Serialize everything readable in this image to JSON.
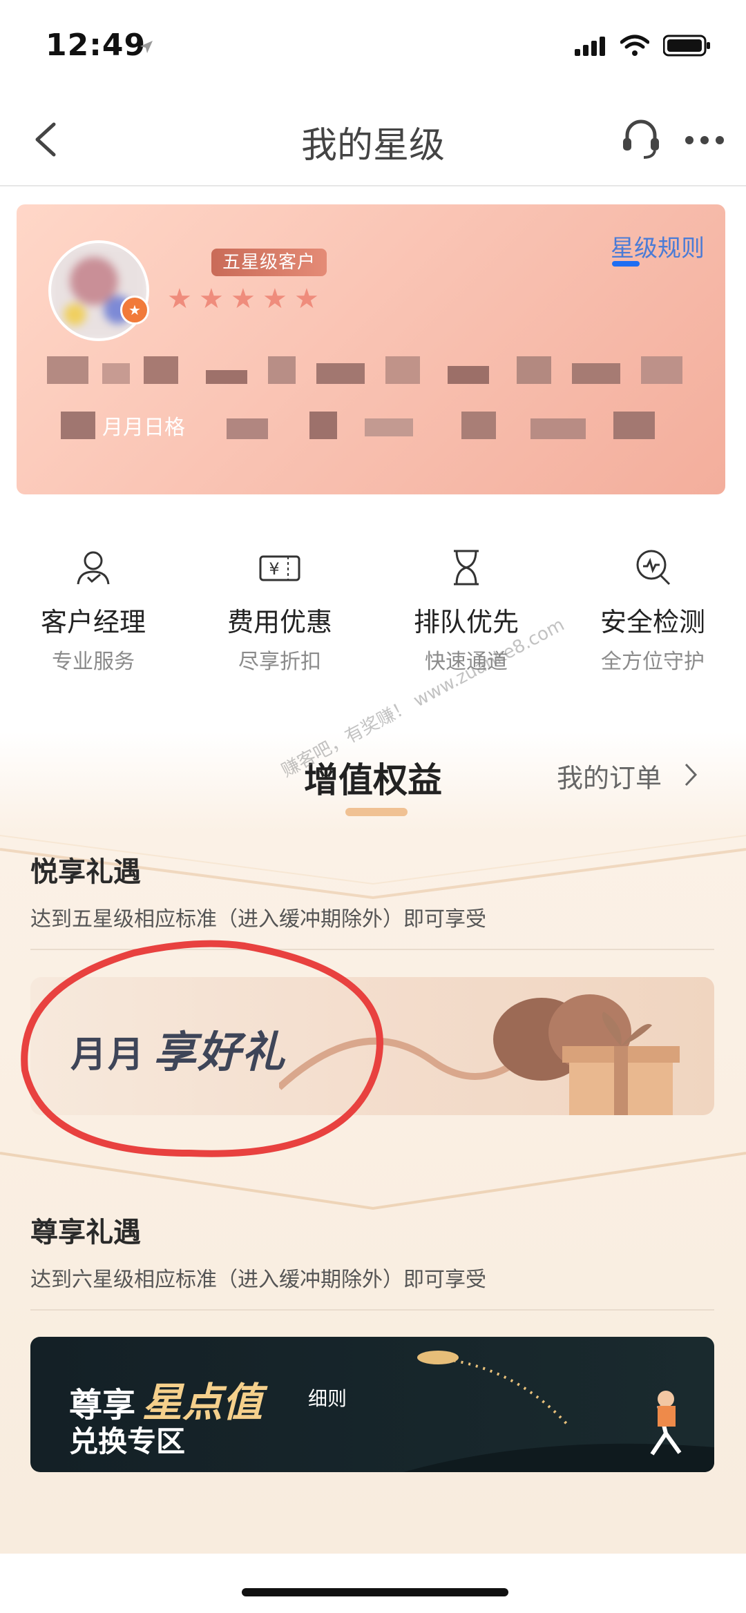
{
  "status_bar": {
    "time": "12:49"
  },
  "nav": {
    "title": "我的星级"
  },
  "card": {
    "level_badge": "五星级客户",
    "stars": 5,
    "rules_link": "星级规则",
    "blurred_text": "月月日格"
  },
  "benefits": [
    {
      "title": "客户经理",
      "sub": "专业服务",
      "icon": "user-icon"
    },
    {
      "title": "费用优惠",
      "sub": "尽享折扣",
      "icon": "ticket-yen-icon"
    },
    {
      "title": "排队优先",
      "sub": "快速通道",
      "icon": "hourglass-icon"
    },
    {
      "title": "安全检测",
      "sub": "全方位守护",
      "icon": "shield-scan-icon"
    }
  ],
  "value_added": {
    "title": "增值权益",
    "my_orders": "我的订单"
  },
  "section1": {
    "title": "悦享礼遇",
    "desc": "达到五星级相应标准（进入缓冲期除外）即可享受",
    "banner_prefix": "月月",
    "banner_main": "享好礼"
  },
  "section2": {
    "title": "尊享礼遇",
    "desc": "达到六星级相应标准（进入缓冲期除外）即可享受",
    "banner_l1_a": "尊享",
    "banner_l1_b": "星点值",
    "banner_detail": "细则",
    "banner_l2": "兑换专区"
  },
  "watermark": "赚客吧，有奖赚！ www.zuanke8.com",
  "colors": {
    "accent": "#4a7bd6",
    "card": "#f9c2b2",
    "highlight_circle": "#e8413f"
  }
}
